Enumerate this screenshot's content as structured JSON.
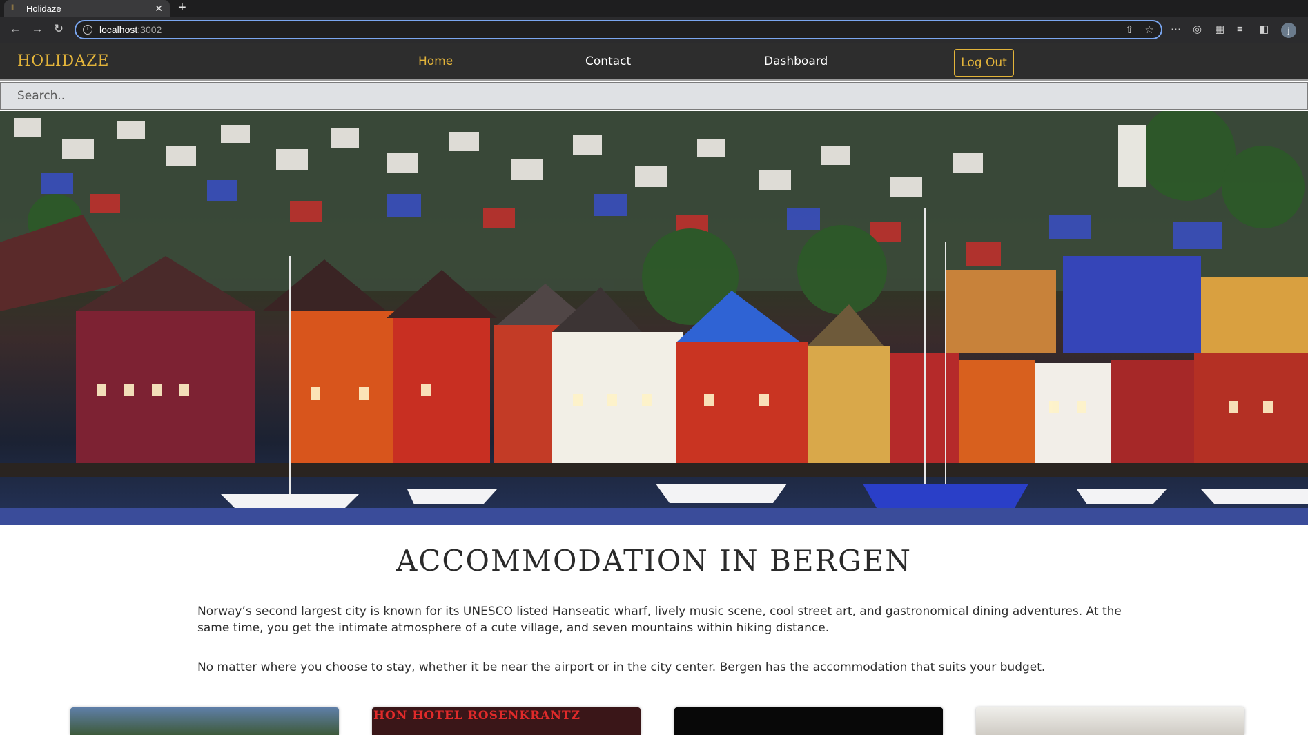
{
  "browser": {
    "tab_title": "Holidaze",
    "url_host": "localhost",
    "url_port": ":3002",
    "profile_initial": "j"
  },
  "site": {
    "brand": "HOLIDAZE",
    "nav": {
      "home": "Home",
      "contact": "Contact",
      "dashboard": "Dashboard",
      "logout": "Log Out"
    },
    "search_placeholder": "Search.."
  },
  "hero": {
    "image": "Bergen Bryggen harbour with colorful wooden houses and boats"
  },
  "content": {
    "title": "ACCOMMODATION IN BERGEN",
    "paragraph1": "Norway’s second largest city is known for its UNESCO listed Hanseatic wharf, lively music scene, cool street art, and gastronomical dining adventures. At the same time, you get the intimate atmosphere of a cute village, and seven mountains within hiking distance.",
    "paragraph2": "No matter where you choose to stay, whether it be near the airport or in the city center. Bergen has the accommodation that suits your budget.",
    "card2_sign": "HON HOTEL ROSENKRANTZ"
  },
  "colors": {
    "accent": "#e3b43a",
    "nav_bg": "#2d2d2d"
  }
}
